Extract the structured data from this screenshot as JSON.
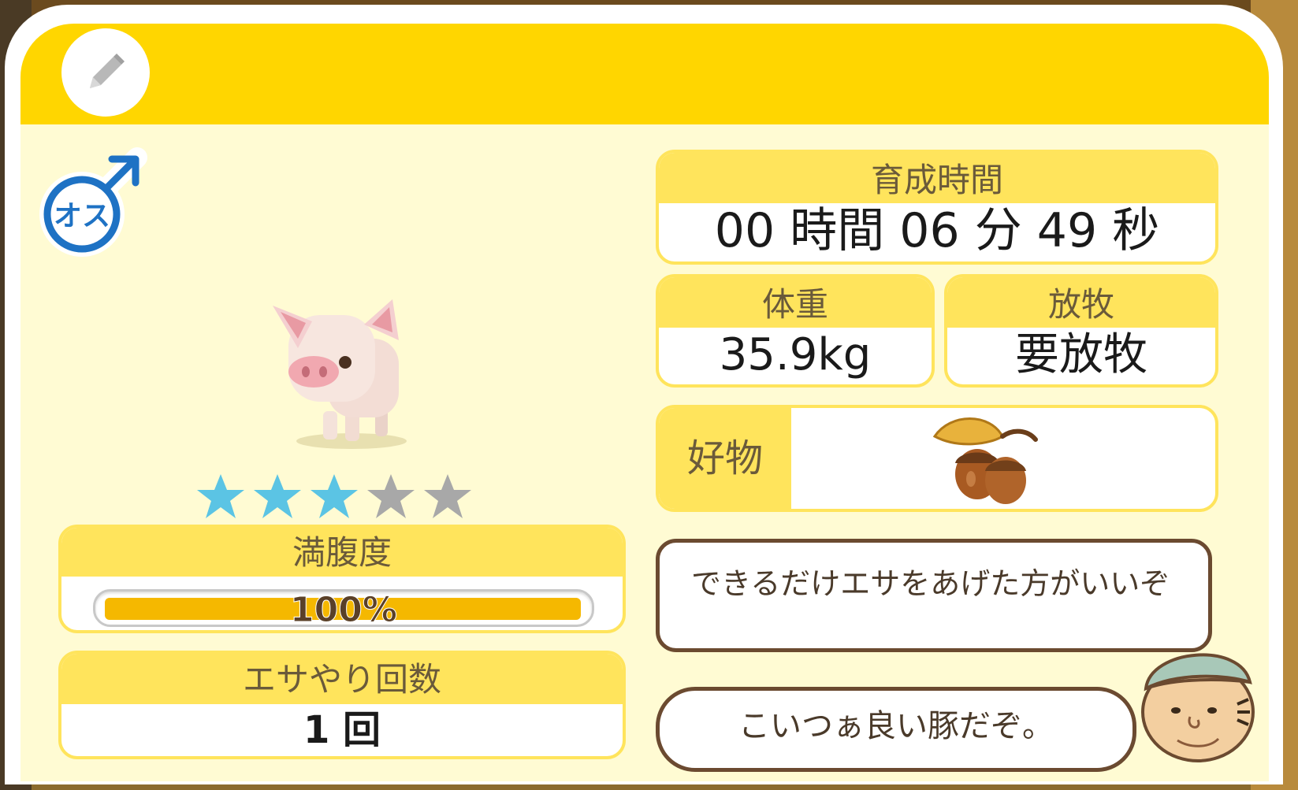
{
  "panel": {
    "edit_icon": "pencil-icon",
    "gender_label": "オス",
    "gender_icon": "male-symbol-icon"
  },
  "animal": {
    "image": "pig-icon",
    "stars_filled": 3,
    "stars_total": 5,
    "colors": {
      "star_filled": "#5bc4e4",
      "star_empty": "#a8a8a8"
    }
  },
  "hunger": {
    "label": "満腹度",
    "value_text": "100%",
    "fraction": 1.0
  },
  "feed_count": {
    "label": "エサやり回数",
    "value": "1 回"
  },
  "grow_time": {
    "label": "育成時間",
    "value": "00 時間 06 分 49 秒"
  },
  "weight": {
    "label": "体重",
    "value": "35.9kg"
  },
  "graze": {
    "label": "放牧",
    "value": "要放牧"
  },
  "favorite": {
    "label": "好物",
    "icon": "acorn-icon"
  },
  "dialogue": {
    "line1": "できるだけエサをあげた方がいいぞ",
    "line2": "こいつぁ良い豚だぞ。",
    "speaker_icon": "farmer-icon"
  },
  "colors": {
    "header": "#ffd600",
    "panel_bg": "#fffbd3",
    "label_bg": "#ffe45c",
    "gender_blue": "#1e72c4",
    "bar_fill": "#f5b800"
  }
}
